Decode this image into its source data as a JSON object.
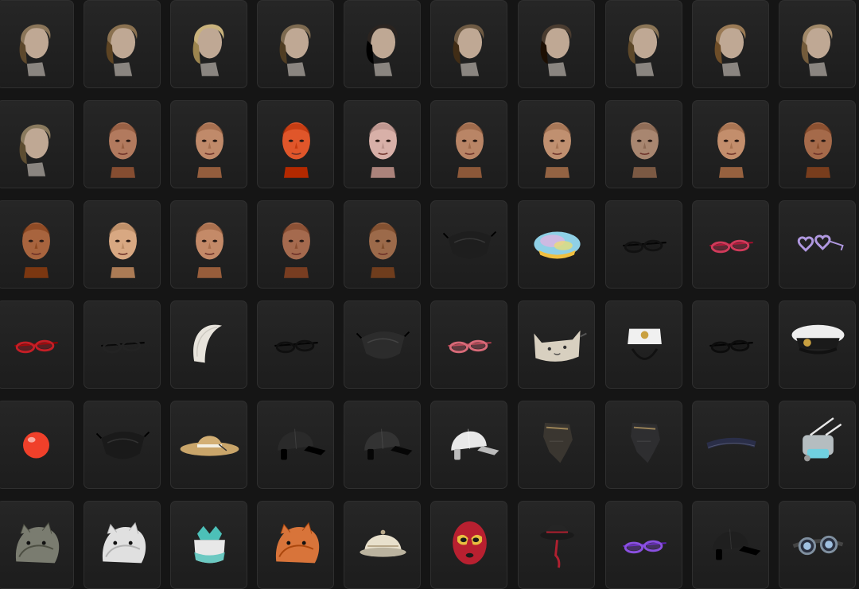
{
  "inventory": {
    "rows": [
      [
        {
          "name": "hair-wavy-bob-icon",
          "kind": "hair",
          "color": "#8a7559"
        },
        {
          "name": "hair-ponytail-icon",
          "kind": "hair",
          "color": "#8a7150"
        },
        {
          "name": "hair-blonde-bun-icon",
          "kind": "hair",
          "color": "#c9b27c"
        },
        {
          "name": "hair-short-bob-icon",
          "kind": "hair",
          "color": "#7d6a50"
        },
        {
          "name": "hair-buzz-cut-icon",
          "kind": "hair",
          "color": "#2b2420"
        },
        {
          "name": "hair-braids-icon",
          "kind": "hair",
          "color": "#6e5a43"
        },
        {
          "name": "hair-topknot-icon",
          "kind": "hair",
          "color": "#4a3c30"
        },
        {
          "name": "hair-bob-bangs-icon",
          "kind": "hair",
          "color": "#8b7556"
        },
        {
          "name": "hair-straight-bob-icon",
          "kind": "hair",
          "color": "#9a7a55"
        },
        {
          "name": "hair-long-bob-icon",
          "kind": "hair",
          "color": "#a08868"
        }
      ],
      [
        {
          "name": "hair-bowl-cut-icon",
          "kind": "hair",
          "color": "#8a7a5e"
        },
        {
          "name": "face-bald-male-icon",
          "kind": "face",
          "color": "#b27a5e"
        },
        {
          "name": "face-female-makeup-icon",
          "kind": "face",
          "color": "#c08a6a"
        },
        {
          "name": "face-orange-paint-icon",
          "kind": "face",
          "color": "#e0562a"
        },
        {
          "name": "face-purple-paint-icon",
          "kind": "face",
          "color": "#d8b0a8"
        },
        {
          "name": "face-bald-male-2-icon",
          "kind": "face",
          "color": "#b98566"
        },
        {
          "name": "face-bald-male-3-icon",
          "kind": "face",
          "color": "#c09070"
        },
        {
          "name": "face-bearded-male-icon",
          "kind": "face",
          "color": "#a88670"
        },
        {
          "name": "face-shaved-female-icon",
          "kind": "face",
          "color": "#c38e6c"
        },
        {
          "name": "face-tanned-female-icon",
          "kind": "face",
          "color": "#a56a4a"
        }
      ],
      [
        {
          "name": "face-red-hair-female-icon",
          "kind": "face",
          "color": "#a8643e"
        },
        {
          "name": "face-pale-female-icon",
          "kind": "face",
          "color": "#d8a882"
        },
        {
          "name": "face-freckled-female-icon",
          "kind": "face",
          "color": "#c48a68"
        },
        {
          "name": "face-dark-hair-female-icon",
          "kind": "face",
          "color": "#a56a4e"
        },
        {
          "name": "face-brown-female-icon",
          "kind": "face",
          "color": "#9c6a4a"
        },
        {
          "name": "black-face-mask-icon",
          "kind": "mask",
          "color": "#1e1e1e"
        },
        {
          "name": "colorful-beret-icon",
          "kind": "beret",
          "color": "#8fd0e6"
        },
        {
          "name": "black-glasses-icon",
          "kind": "glasses",
          "color": "#111111"
        },
        {
          "name": "gradient-sunglasses-icon",
          "kind": "glasses",
          "color": "#d03a5a"
        },
        {
          "name": "heart-glasses-icon",
          "kind": "heart",
          "color": "#b098e0"
        }
      ],
      [
        {
          "name": "red-glasses-icon",
          "kind": "glasses",
          "color": "#c41e26"
        },
        {
          "name": "black-sunglasses-icon",
          "kind": "glasses",
          "color": "#232323"
        },
        {
          "name": "white-headband-icon",
          "kind": "headband",
          "color": "#e8e4dc"
        },
        {
          "name": "dark-glasses-icon",
          "kind": "glasses",
          "color": "#0f0f0f"
        },
        {
          "name": "studded-leather-mask-icon",
          "kind": "mask",
          "color": "#2c2c2c"
        },
        {
          "name": "pink-glasses-icon",
          "kind": "glasses",
          "color": "#d86a78"
        },
        {
          "name": "cat-face-mask-icon",
          "kind": "catmask",
          "color": "#d8d0c0"
        },
        {
          "name": "white-captain-hat-icon",
          "kind": "captain",
          "color": "#f0f0f0"
        },
        {
          "name": "cat-eye-glasses-icon",
          "kind": "glasses",
          "color": "#0c0c0c"
        },
        {
          "name": "officer-cap-icon",
          "kind": "officer",
          "color": "#eeeeee"
        }
      ],
      [
        {
          "name": "clown-nose-icon",
          "kind": "nose",
          "color": "#f0402a"
        },
        {
          "name": "black-red-mask-icon",
          "kind": "mask",
          "color": "#1a1a1a"
        },
        {
          "name": "straw-sun-hat-icon",
          "kind": "strawhat",
          "color": "#c9a56a"
        },
        {
          "name": "black-red-cap-icon",
          "kind": "cap",
          "color": "#2a2a2a"
        },
        {
          "name": "black-cap-icon",
          "kind": "cap",
          "color": "#333333"
        },
        {
          "name": "white-cap-icon",
          "kind": "cap",
          "color": "#e8e8e8"
        },
        {
          "name": "bandana-wrap-icon",
          "kind": "bandana",
          "color": "#3a3630"
        },
        {
          "name": "dark-bandana-icon",
          "kind": "bandana",
          "color": "#2e2e30"
        },
        {
          "name": "navy-headband-icon",
          "kind": "band",
          "color": "#2a2e48"
        },
        {
          "name": "respirator-mask-icon",
          "kind": "respirator",
          "color": "#cfd8dc"
        }
      ],
      [
        {
          "name": "dinosaur-head-icon",
          "kind": "animal",
          "color": "#7a7c70"
        },
        {
          "name": "cow-mask-icon",
          "kind": "animal",
          "color": "#e0e0e0"
        },
        {
          "name": "teal-bow-hat-icon",
          "kind": "bowhat",
          "color": "#4cc0b8"
        },
        {
          "name": "fox-mask-icon",
          "kind": "animal",
          "color": "#d8743a"
        },
        {
          "name": "pith-helmet-icon",
          "kind": "helmet",
          "color": "#e8e0cc"
        },
        {
          "name": "luchador-mask-icon",
          "kind": "luchador",
          "color": "#b82030"
        },
        {
          "name": "bowler-hat-icon",
          "kind": "bowler",
          "color": "#252525"
        },
        {
          "name": "purple-sunglasses-icon",
          "kind": "glasses",
          "color": "#8a50e0"
        },
        {
          "name": "black-baseball-cap-icon",
          "kind": "cap",
          "color": "#1f1f1f"
        },
        {
          "name": "steampunk-goggles-icon",
          "kind": "goggles",
          "color": "#8090a0"
        }
      ]
    ]
  }
}
